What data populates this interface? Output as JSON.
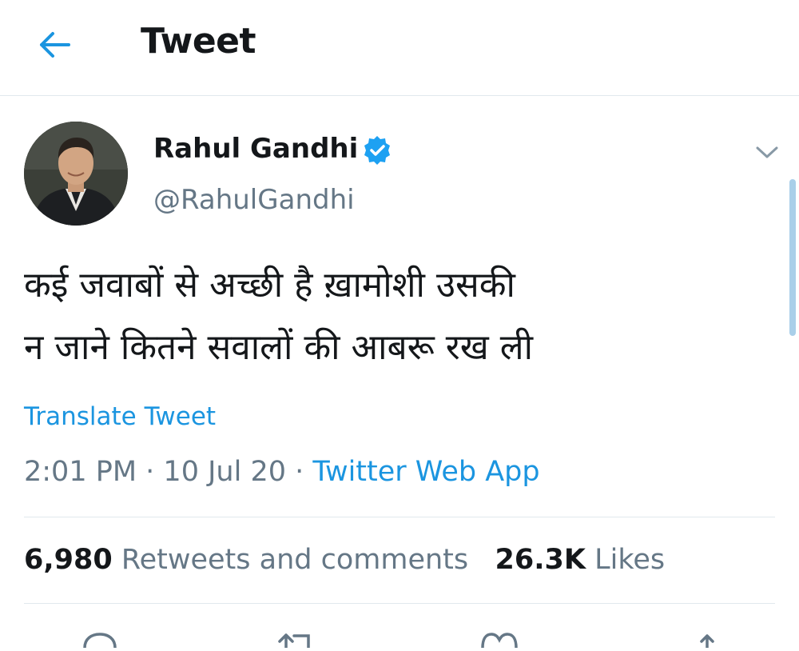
{
  "header": {
    "title": "Tweet",
    "back_icon": "arrow-left-icon"
  },
  "author": {
    "name": "Rahul Gandhi",
    "handle": "@RahulGandhi",
    "verified": true
  },
  "tweet": {
    "lines": [
      "कई जवाबों से अच्छी है ख़ामोशी उसकी",
      "न जाने कितने सवालों की आबरू रख ली"
    ],
    "translate_label": "Translate Tweet",
    "time": "2:01 PM",
    "separator": " · ",
    "date": "10 Jul 20",
    "source": "Twitter Web App"
  },
  "stats": {
    "retweets_count": "6,980",
    "retweets_label": "Retweets and comments",
    "likes_count": "26.3K",
    "likes_label": "Likes"
  },
  "colors": {
    "accent": "#1b95e0",
    "text": "#14171a",
    "secondary": "#657786",
    "divider": "#e1e8ed"
  },
  "icons": {
    "verified": "verified-badge-icon",
    "caret": "chevron-down-icon",
    "reply": "reply-icon",
    "retweet": "retweet-icon",
    "like": "heart-icon",
    "share": "share-icon"
  }
}
